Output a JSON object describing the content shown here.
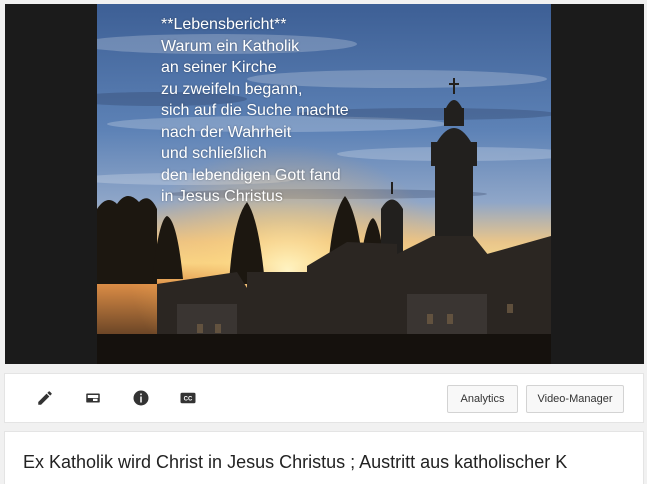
{
  "video": {
    "overlay_lines": [
      "**Lebensbericht**",
      "Warum ein Katholik",
      "an seiner Kirche",
      "zu zweifeln begann,",
      "sich auf die Suche machte",
      "nach der Wahrheit",
      "und schließlich",
      "den lebendigen Gott fand",
      "in Jesus Christus"
    ]
  },
  "toolbar": {
    "icons": [
      "edit-pencil-icon",
      "enhancements-icon",
      "info-icon",
      "closed-captions-icon"
    ],
    "analytics_label": "Analytics",
    "video_manager_label": "Video-Manager"
  },
  "title": {
    "text": "Ex Katholik wird Christ in Jesus Christus ; Austritt aus katholischer K"
  },
  "colors": {
    "player_bg": "#1b1b1b",
    "page_bg": "#f1f1f1",
    "icon": "#333333"
  }
}
